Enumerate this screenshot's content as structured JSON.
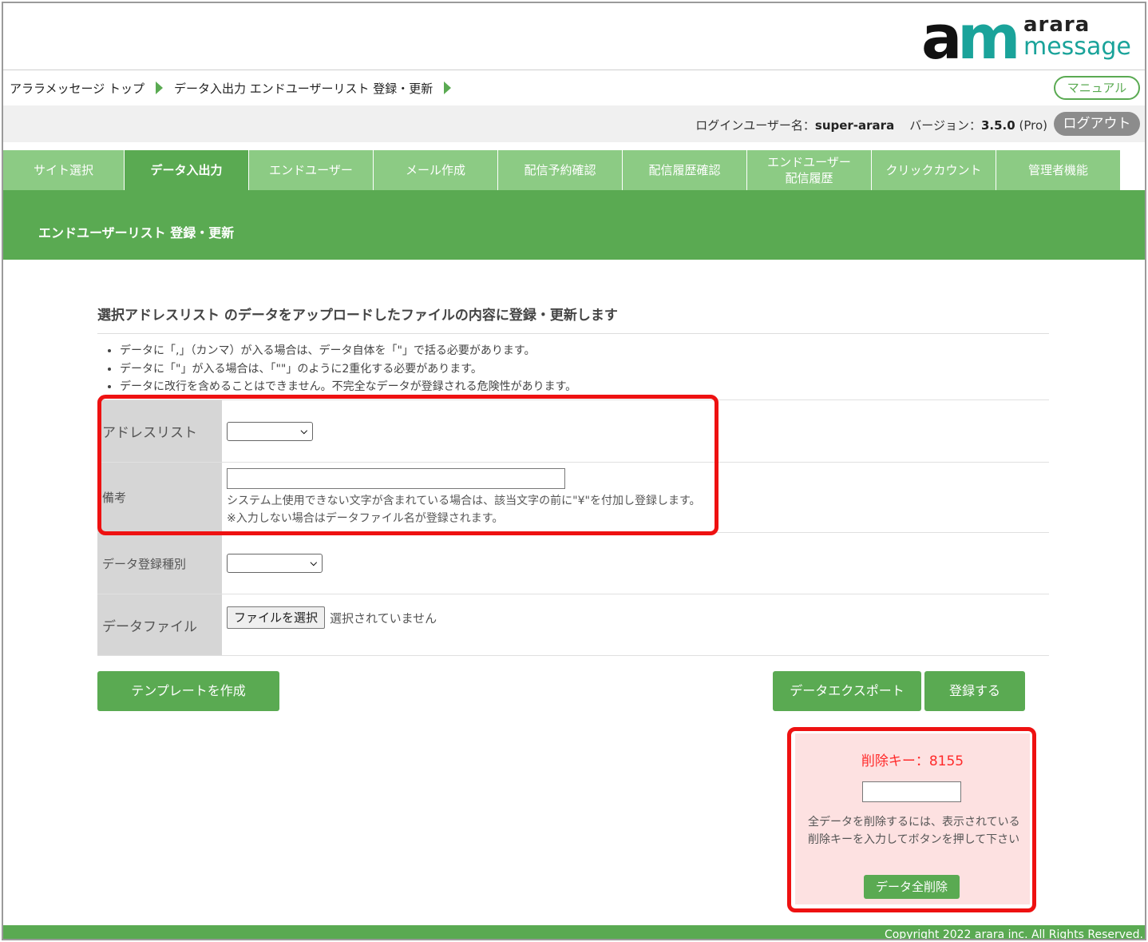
{
  "logo": {
    "mark_a": "a",
    "mark_m": "m",
    "word1": "arara",
    "word2": "message"
  },
  "breadcrumb": {
    "home": "アララメッセージ トップ",
    "current": "データ入出力 エンドユーザーリスト 登録・更新"
  },
  "header_buttons": {
    "manual": "マニュアル",
    "logout": "ログアウト"
  },
  "login": {
    "user_label": "ログインユーザー名：",
    "user_name": "super-arara",
    "version_label": "バージョン：",
    "version": "3.5.0",
    "edition": "(Pro)"
  },
  "nav": {
    "tabs": [
      {
        "label": "サイト選択"
      },
      {
        "label": "データ入出力",
        "active": true
      },
      {
        "label": "エンドユーザー"
      },
      {
        "label": "メール作成"
      },
      {
        "label": "配信予約確認"
      },
      {
        "label": "配信履歴確認"
      },
      {
        "label": "エンドユーザー",
        "label2": "配信履歴"
      },
      {
        "label": "クリックカウント"
      },
      {
        "label": "管理者機能"
      }
    ]
  },
  "banner": {
    "title": "エンドユーザーリスト 登録・更新"
  },
  "content": {
    "title": "選択アドレスリスト のデータをアップロードしたファイルの内容に登録・更新します",
    "notes": [
      "データに「,」（カンマ）が入る場合は、データ自体を「\"」で括る必要があります。",
      "データに「\"」が入る場合は、「\"\"」のように2重化する必要があります。",
      "データに改行を含めることはできません。不完全なデータが登録される危険性があります。"
    ]
  },
  "form": {
    "address_list": {
      "label": "アドレスリスト",
      "value": ""
    },
    "memo": {
      "label": "備考",
      "value": "",
      "hint1": "システム上使用できない文字が含まれている場合は、該当文字の前に\"¥\"を付加し登録します。",
      "hint2": "※入力しない場合はデータファイル名が登録されます。"
    },
    "registration_type": {
      "label": "データ登録種別",
      "value": ""
    },
    "data_file": {
      "label": "データファイル",
      "button": "ファイルを選択",
      "status": "選択されていません"
    }
  },
  "actions": {
    "template": "テンプレートを作成",
    "export": "データエクスポート",
    "register": "登録する"
  },
  "delete_panel": {
    "key_label": "削除キー：8155",
    "input_value": "",
    "description": "全データを削除するには、表示されている削除キーを入力してボタンを押して下さい",
    "button": "データ全削除"
  },
  "footer": {
    "copyright": "Copyright 2022 arara inc. All Rights Reserved."
  },
  "colors": {
    "brand_green": "#5aaa52",
    "tab_green": "#8ccb84",
    "logo_teal": "#1aa39a",
    "delete_key_red": "#ff2a2a",
    "delete_panel_bg": "#fde1e1",
    "annotation_red": "#ee1111"
  }
}
